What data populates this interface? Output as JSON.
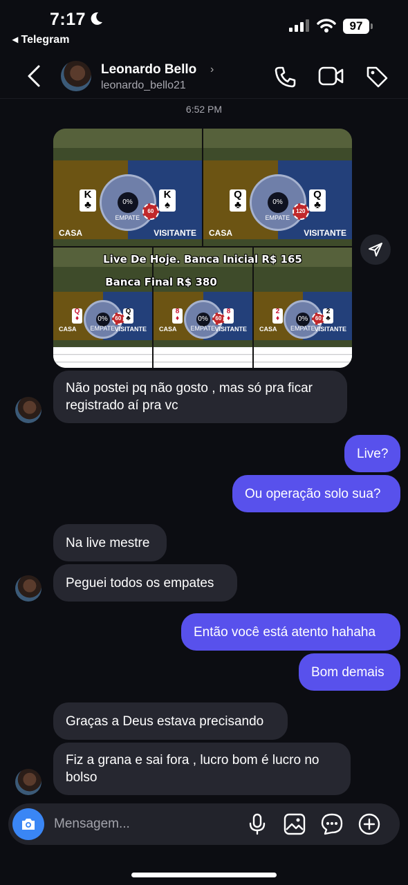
{
  "status_bar": {
    "time": "7:17",
    "back_app": "◂ Telegram",
    "battery": "97"
  },
  "header": {
    "name": "Leonardo Bello",
    "username": "leonardo_bello21"
  },
  "timestamp": "6:52 PM",
  "shared_image": {
    "overlay_line1": "Live De Hoje. Banca Inicial R$ 165",
    "overlay_line2": "Banca Final R$ 380",
    "tiles": [
      {
        "left_card": "K",
        "left_suit": "♣",
        "right_card": "K",
        "right_suit": "♠",
        "badge": "60",
        "casa": "CASA",
        "visitante": "VISITANTE",
        "empate": "EMPATE",
        "pct": "0%"
      },
      {
        "left_card": "Q",
        "left_suit": "♣",
        "right_card": "Q",
        "right_suit": "♣",
        "badge": "120",
        "casa": "CASA",
        "visitante": "VISITANTE",
        "empate": "EMPATE",
        "pct": "0%"
      },
      {
        "left_card": "Q",
        "left_suit": "♦",
        "right_card": "Q",
        "right_suit": "♣",
        "badge": "60",
        "casa": "CASA",
        "visitante": "VISITANTE",
        "empate": "EMPATE",
        "pct": "0%"
      },
      {
        "left_card": "8",
        "left_suit": "♦",
        "right_card": "8",
        "right_suit": "♦",
        "badge": "60",
        "casa": "CASA",
        "visitante": "VISITANTE",
        "empate": "EMPATE",
        "pct": "0%"
      },
      {
        "left_card": "2",
        "left_suit": "♦",
        "right_card": "2",
        "right_suit": "♣",
        "badge": "60",
        "casa": "CASA",
        "visitante": "VISITANTE",
        "empate": "EMPATE",
        "pct": "0%"
      }
    ]
  },
  "messages": [
    {
      "dir": "in",
      "text": "Não postei pq não gosto , mas só pra ficar registrado aí pra vc"
    },
    {
      "dir": "out",
      "text": "Live?"
    },
    {
      "dir": "out",
      "text": "Ou operação solo sua?"
    },
    {
      "dir": "in",
      "text": "Na live mestre"
    },
    {
      "dir": "in",
      "text": "Peguei todos os empates"
    },
    {
      "dir": "out",
      "text": "Então você está atento hahaha"
    },
    {
      "dir": "out",
      "text": "Bom demais"
    },
    {
      "dir": "in",
      "text": "Graças a Deus estava precisando"
    },
    {
      "dir": "in",
      "text": "Fiz a grana e sai fora , lucro bom é lucro no bolso"
    }
  ],
  "composer": {
    "placeholder": "Mensagem..."
  }
}
